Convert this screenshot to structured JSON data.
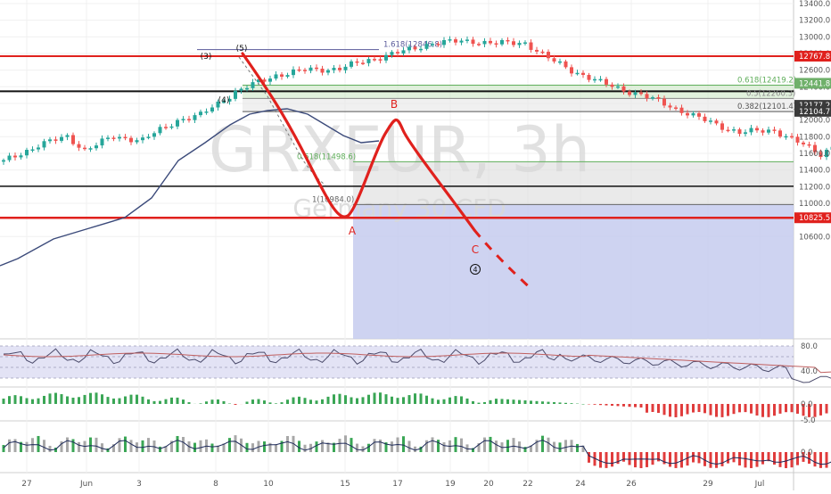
{
  "chart_data": {
    "type": "line",
    "symbol_watermark": "GRXEUR, 3h",
    "name_watermark": "Germany 30 CFD",
    "price_axis": {
      "ylim": [
        10500,
        13400
      ],
      "ticks": [
        13400,
        13200,
        13000,
        12800,
        12600,
        12400,
        12200,
        12000,
        11800,
        11600,
        11400,
        11200,
        11000,
        10600
      ]
    },
    "time_axis": {
      "labels": [
        "27",
        "Jun",
        "3",
        "8",
        "10",
        "15",
        "17",
        "19",
        "20",
        "22",
        "24",
        "26",
        "29",
        "Jul"
      ]
    },
    "price_tags": [
      {
        "label": "12767.8",
        "value": 12767.8,
        "color": "#e0211d"
      },
      {
        "label": "12441.8",
        "value": 12441.8,
        "color": "#6fb06a"
      },
      {
        "label": "12177.2",
        "value": 12177.2,
        "color": "#3a3a3a"
      },
      {
        "label": "12104.7",
        "value": 12104.7,
        "color": "#3a3a3a"
      },
      {
        "label": "10825.5",
        "value": 10825.5,
        "color": "#e0211d"
      }
    ],
    "horizontal_lines": [
      {
        "value": 12767.8,
        "color": "#e0211d",
        "width": 2
      },
      {
        "value": 12346,
        "color": "#111111",
        "width": 2
      },
      {
        "value": 11205,
        "color": "#111111",
        "width": 1.5
      },
      {
        "value": 10825.5,
        "color": "#e0211d",
        "width": 2.5
      }
    ],
    "fib_levels": [
      {
        "label": "1.618(12846.8)",
        "value": 12846.8,
        "color": "#5a5a9a"
      },
      {
        "label": "0.618(12419.2)",
        "value": 12419.2,
        "color": "#5fae5a"
      },
      {
        "label": "0.5(12260.3)",
        "value": 12260.3,
        "color": "#888888"
      },
      {
        "label": "0.382(12101.4)",
        "value": 12101.4,
        "color": "#555555"
      },
      {
        "label": "0.618(11498.6)",
        "value": 11498.6,
        "color": "#5fae5a"
      },
      {
        "label": "1(10984.0)",
        "value": 10984.0,
        "color": "#666666"
      }
    ],
    "wave_labels": [
      {
        "text": "(3)",
        "color": "#111111"
      },
      {
        "text": "(4)",
        "color": "#111111"
      },
      {
        "text": "(5)",
        "color": "#111111"
      },
      {
        "text": "A",
        "color": "#e0211d"
      },
      {
        "text": "B",
        "color": "#e0211d"
      },
      {
        "text": "C",
        "color": "#e0211d"
      },
      {
        "text": "4",
        "color": "#111111"
      }
    ],
    "rsi": {
      "ticks": [
        80.0,
        40.0
      ]
    },
    "macd": {
      "ticks": [
        0.0,
        -5.0
      ]
    },
    "osc": {
      "ticks": [
        0.0
      ]
    },
    "colors": {
      "up": "#26a69a",
      "down": "#ef5350",
      "ma": "#3b4a7a",
      "projection": "#e0211d"
    }
  }
}
